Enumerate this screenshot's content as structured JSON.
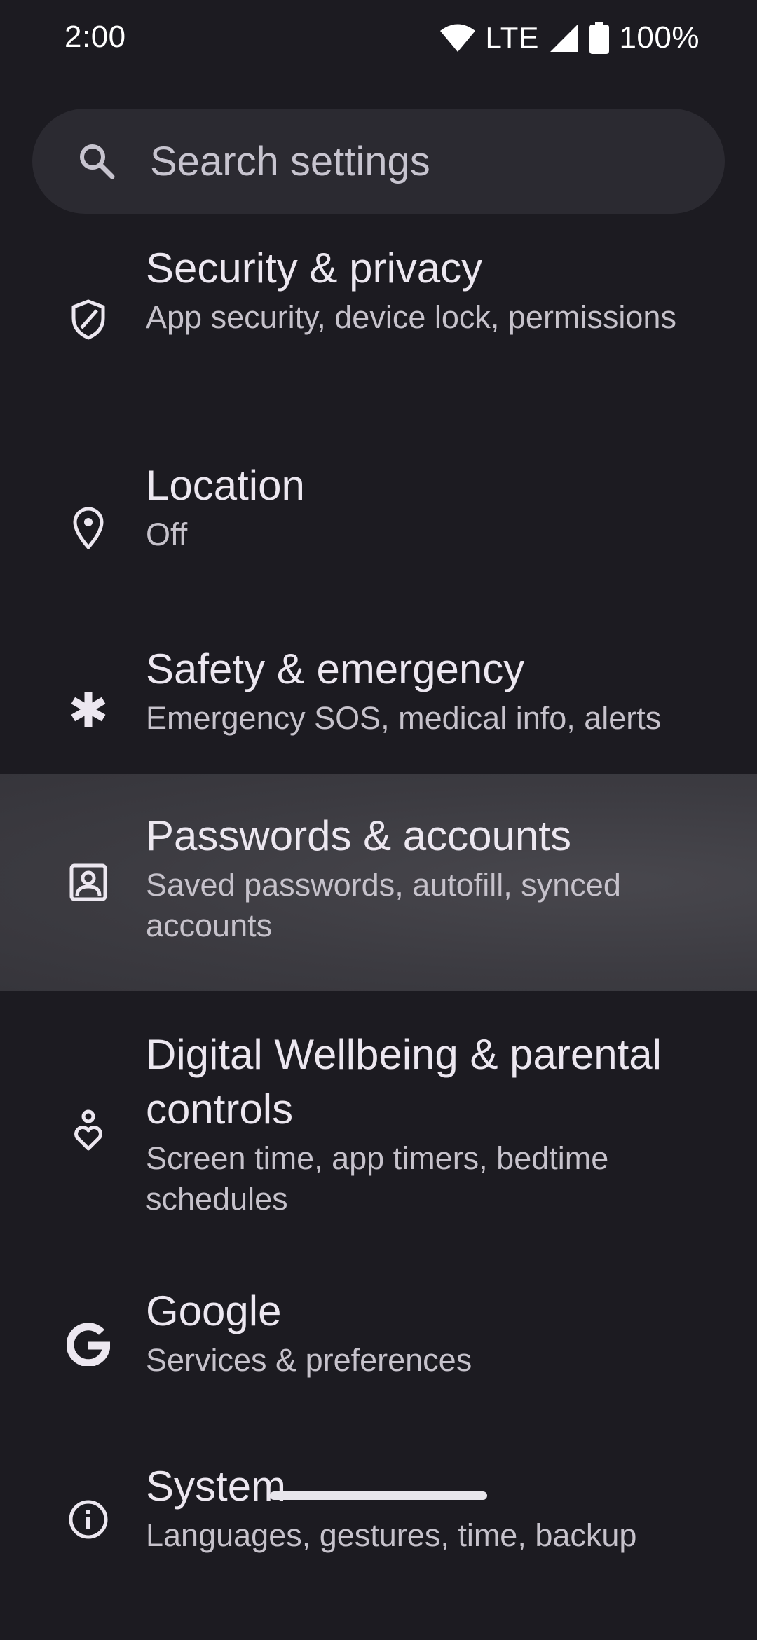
{
  "status_bar": {
    "time": "2:00",
    "network": "LTE",
    "battery": "100%",
    "icons": [
      "wifi-icon",
      "cell-signal-icon",
      "battery-icon"
    ]
  },
  "search": {
    "placeholder": "Search settings",
    "icon": "search-icon"
  },
  "settings": [
    {
      "title": "Security & privacy",
      "subtitle": "App security, device lock, permissions",
      "icon": "shield-icon"
    },
    {
      "title": "Location",
      "subtitle": "Off",
      "icon": "location-pin-icon"
    },
    {
      "title": "Safety & emergency",
      "subtitle": "Emergency SOS, medical info, alerts",
      "icon": "asterisk-icon"
    },
    {
      "title": "Passwords & accounts",
      "subtitle": "Saved passwords, autofill, synced accounts",
      "icon": "account-box-icon",
      "highlighted": true
    },
    {
      "title": "Digital Wellbeing & parental controls",
      "subtitle": "Screen time, app timers, bedtime schedules",
      "icon": "wellbeing-icon"
    },
    {
      "title": "Google",
      "subtitle": "Services & preferences",
      "icon": "google-icon"
    },
    {
      "title": "System",
      "subtitle": "Languages, gestures, time, backup",
      "icon": "info-icon"
    }
  ],
  "colors": {
    "background": "#1c1b21",
    "search_bar": "#2b2a31",
    "highlight": "#3e3d43",
    "title_text": "#ece7f0",
    "subtitle_text": "#c6c2cb"
  }
}
